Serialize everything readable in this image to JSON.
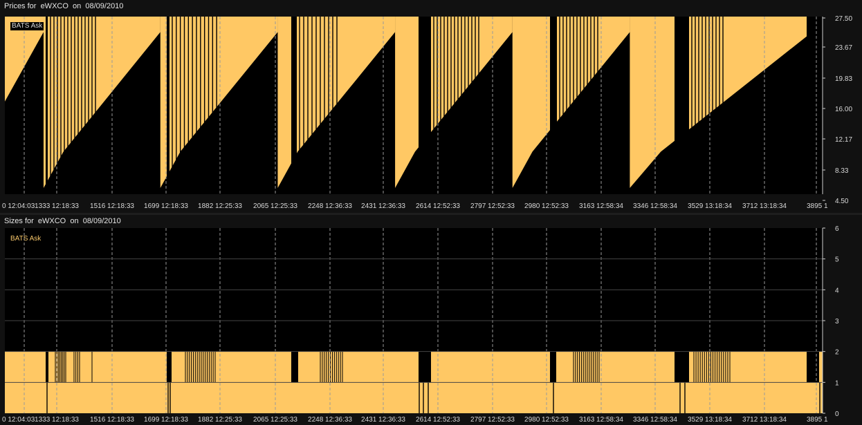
{
  "colors": {
    "series": "#ffc864",
    "plot_bg": "#000000",
    "grid": "#9a9a9a",
    "text": "#d9d9d9"
  },
  "price_panel": {
    "title": "Prices for  eWXCO  on  08/09/2010",
    "legend": "BATS Ask"
  },
  "size_panel": {
    "title": "Sizes for  eWXCO  on  08/09/2010",
    "legend": "BATS Ask"
  },
  "chart_data": [
    {
      "type": "area",
      "series_name": "BATS Ask",
      "ylim": [
        4.5,
        27.5
      ],
      "yticks": [
        "27.50",
        "23.67",
        "19.83",
        "16.00",
        "12.17",
        "8.33",
        "4.50"
      ],
      "xticks": [
        "0 12:04:03",
        "1333 12:18:33",
        "1516 12:18:33",
        "1699 12:18:33",
        "1882 12:25:33",
        "2065 12:25:33",
        "2248 12:36:33",
        "2431 12:36:33",
        "2614 12:52:33",
        "2797 12:52:33",
        "2980 12:52:33",
        "3163 12:58:34",
        "3346 12:58:34",
        "3529 13:18:34",
        "3712 13:18:34",
        "3895 1"
      ],
      "x_range": [
        1150,
        3895
      ],
      "cycles": [
        {
          "start": 1150,
          "end": 1280,
          "low": 16.5,
          "high": 25.5
        },
        {
          "start": 1280,
          "end": 1672,
          "low": 5.3,
          "high": 25.5
        },
        {
          "start": 1672,
          "end": 2066,
          "low": 5.3,
          "high": 25.5
        },
        {
          "start": 2066,
          "end": 2460,
          "low": 5.3,
          "high": 25.5
        },
        {
          "start": 2460,
          "end": 2854,
          "low": 5.3,
          "high": 25.5
        },
        {
          "start": 2854,
          "end": 3248,
          "low": 5.3,
          "high": 25.5
        },
        {
          "start": 3248,
          "end": 3860,
          "low": 5.3,
          "high": 25.5
        }
      ]
    },
    {
      "type": "area",
      "series_name": "BATS Ask",
      "ylim": [
        0,
        6
      ],
      "yticks": [
        "6",
        "5",
        "4",
        "3",
        "2",
        "1",
        "0"
      ],
      "xticks": [
        "0 12:04:03",
        "1333 12:18:33",
        "1516 12:18:33",
        "1699 12:18:33",
        "1882 12:25:33",
        "2065 12:25:33",
        "2248 12:36:33",
        "2431 12:36:33",
        "2614 12:52:33",
        "2797 12:52:33",
        "2980 12:52:33",
        "3163 12:58:34",
        "3346 12:58:34",
        "3529 13:18:34",
        "3712 13:18:34",
        "3895 1"
      ],
      "base_value": 2,
      "x_range": [
        1150,
        3895
      ]
    }
  ]
}
